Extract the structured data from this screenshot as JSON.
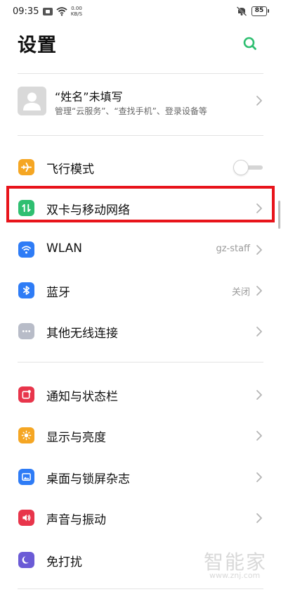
{
  "status_bar": {
    "time": "09:35",
    "net_speed_value": "0.00",
    "net_speed_unit": "KB/S",
    "battery": "85"
  },
  "header": {
    "title": "设置",
    "search_icon": "search-icon"
  },
  "profile": {
    "name": "“姓名”未填写",
    "subtitle": "管理“云服务”、“查找手机”、登录设备等",
    "avatar_icon": "person-icon"
  },
  "sections": [
    {
      "items": [
        {
          "label": "飞行模式",
          "icon": "airplane-icon",
          "icon_color": "#f5a623",
          "control": "toggle",
          "toggle_on": false
        },
        {
          "label": "双卡与移动网络",
          "icon": "dual-sim-icon",
          "icon_color": "#2fbf71",
          "control": "chevron"
        },
        {
          "label": "WLAN",
          "icon": "wifi-icon",
          "icon_color": "#2e7cf6",
          "value": "gz-staff",
          "control": "chevron"
        },
        {
          "label": "蓝牙",
          "icon": "bluetooth-icon",
          "icon_color": "#2e7cf6",
          "value": "关闭",
          "control": "chevron"
        },
        {
          "label": "其他无线连接",
          "icon": "more-icon",
          "icon_color": "#b8bcc8",
          "control": "chevron"
        }
      ]
    },
    {
      "items": [
        {
          "label": "通知与状态栏",
          "icon": "notification-icon",
          "icon_color": "#e8354b",
          "control": "chevron"
        },
        {
          "label": "显示与亮度",
          "icon": "brightness-icon",
          "icon_color": "#f5a623",
          "control": "chevron"
        },
        {
          "label": "桌面与锁屏杂志",
          "icon": "wallpaper-icon",
          "icon_color": "#2e7cf6",
          "control": "chevron"
        },
        {
          "label": "声音与振动",
          "icon": "sound-icon",
          "icon_color": "#e8354b",
          "control": "chevron"
        },
        {
          "label": "免打扰",
          "icon": "moon-icon",
          "icon_color": "#6b5bd6",
          "control": "none"
        }
      ]
    }
  ],
  "watermark": {
    "brand": "智能家",
    "url": "www.znj.com"
  },
  "colors": {
    "accent": "#2fbf71",
    "highlight": "#e8141b",
    "divider": "#e3e3e3"
  }
}
